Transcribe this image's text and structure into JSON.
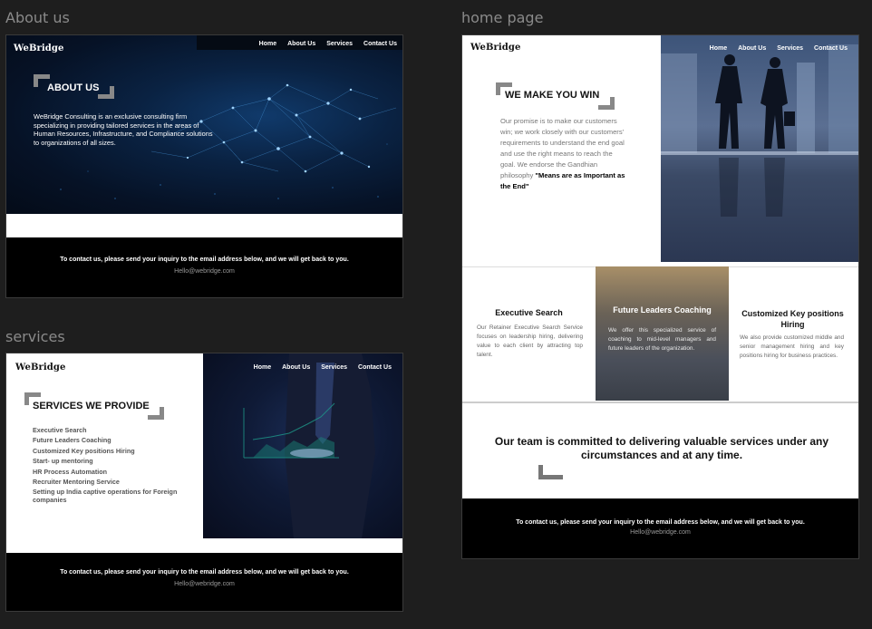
{
  "frames": {
    "about": "About us",
    "services": "services",
    "home": "home page"
  },
  "brand": "WeBridge",
  "nav": [
    "Home",
    "About Us",
    "Services",
    "Contact Us"
  ],
  "about": {
    "title": "ABOUT US",
    "description": "WeBridge Consulting is an exclusive consulting firm specializing in providing tailored services in the areas of Human Resources, Infrastructure, and Compliance solutions to organizations of all sizes."
  },
  "services": {
    "title": "SERVICES WE PROVIDE",
    "items": [
      "Executive Search",
      "Future Leaders Coaching",
      "Customized Key positions Hiring",
      "Start- up mentoring",
      "HR Process Automation",
      "Recruiter Mentoring Service",
      "Setting up India captive operations for Foreign companies"
    ]
  },
  "home": {
    "win_title": "WE MAKE YOU WIN",
    "win_text": "Our promise is to make our customers win; we work closely with our customers' requirements to understand the end goal and use the right means to reach the goal. We endorse the Gandhian philosophy",
    "win_quote": "\"Means are as Important as the End\"",
    "cards": [
      {
        "title": "Executive Search",
        "text": "Our Retainer Executive Search Service focuses on leadership hiring, delivering value to each client by attracting top talent."
      },
      {
        "title": "Future Leaders Coaching",
        "text": "We offer this specialized service of coaching to mid-level managers and future leaders of the organization."
      },
      {
        "title": "Customized Key positions Hiring",
        "text": "We also provide customized middle and senior management hiring and key positions hiring for business practices."
      }
    ],
    "commitment": "Our team is committed to delivering valuable services under any circumstances and at any time."
  },
  "footer": {
    "line": "To contact us, please send your inquiry to the email address below, and we will get back to you.",
    "email": "Hello@webridge.com"
  },
  "colors": {
    "canvas": "#1e1e1e",
    "footer_bg": "#000000",
    "bracket": "#888888"
  }
}
